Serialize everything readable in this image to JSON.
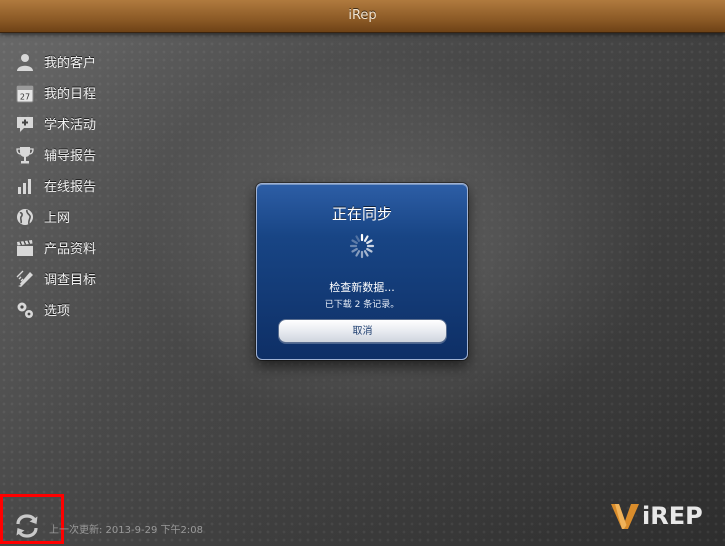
{
  "app": {
    "title": "iRep"
  },
  "sidebar": {
    "items": [
      {
        "label": "我的客户",
        "icon": "person-icon"
      },
      {
        "label": "我的日程",
        "icon": "calendar-icon"
      },
      {
        "label": "学术活动",
        "icon": "add-bubble-icon"
      },
      {
        "label": "辅导报告",
        "icon": "trophy-icon"
      },
      {
        "label": "在线报告",
        "icon": "bar-chart-icon"
      },
      {
        "label": "上网",
        "icon": "globe-icon"
      },
      {
        "label": "产品资料",
        "icon": "clapperboard-icon"
      },
      {
        "label": "调查目标",
        "icon": "pencil-ruler-icon"
      },
      {
        "label": "选项",
        "icon": "gears-icon"
      }
    ],
    "calendar_day": "27"
  },
  "dialog": {
    "title": "正在同步",
    "message": "检查新数据...",
    "status": "已下载 2 条记录。",
    "cancel_label": "取消"
  },
  "footer": {
    "last_update": "上一次更新: 2013-9-29 下午2:08",
    "sync_icon": "sync-icon"
  },
  "logo": {
    "text": "iREP"
  },
  "colors": {
    "titlebar": "#8c5a26",
    "dialog": "#184585",
    "highlight": "#ff0000",
    "logo_orange": "#d98c2b"
  }
}
